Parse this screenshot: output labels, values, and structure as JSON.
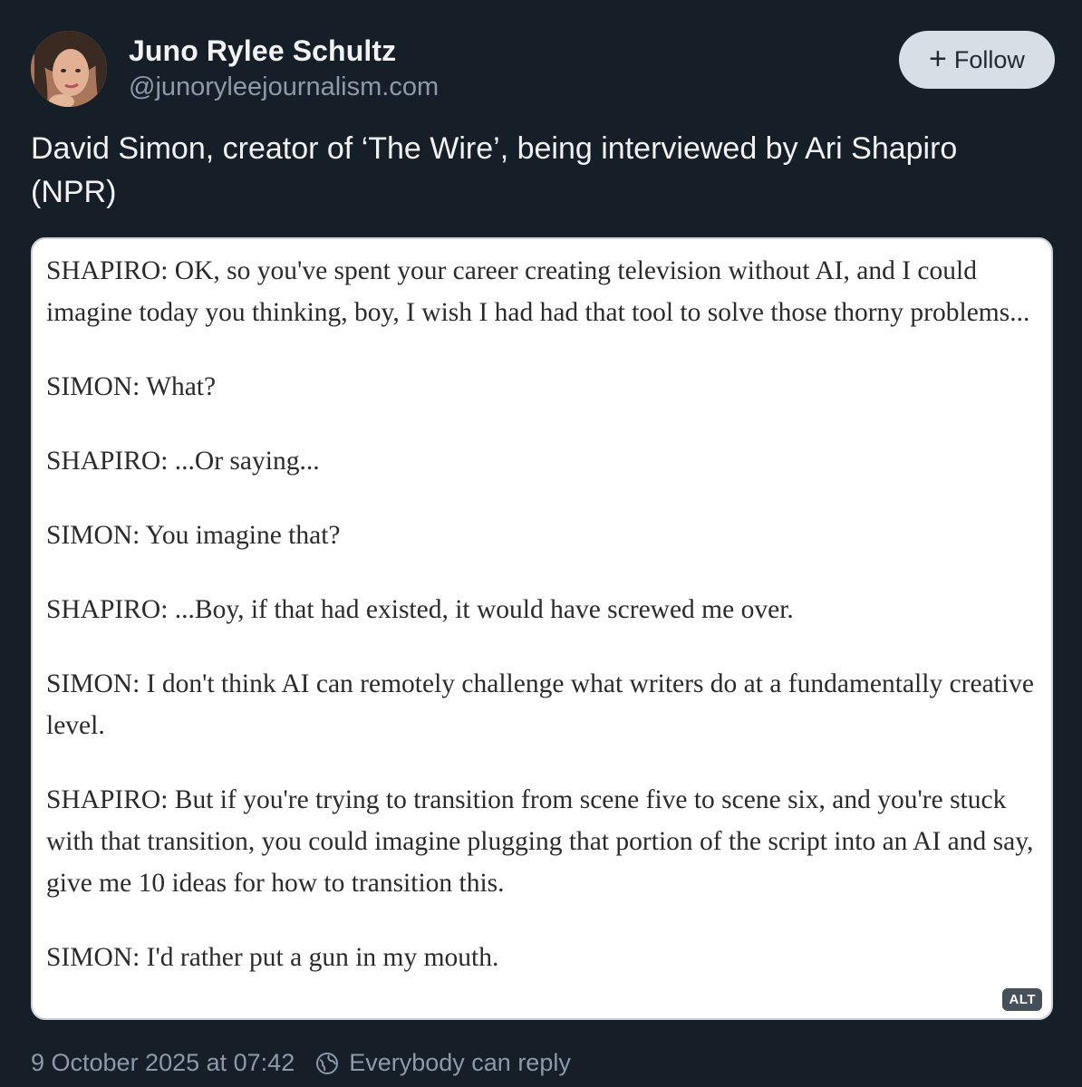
{
  "author": {
    "display_name": "Juno Rylee Schultz",
    "handle": "@junoryleejournalism.com"
  },
  "follow_button": {
    "icon": "plus-icon",
    "label": "Follow"
  },
  "post": {
    "text": "David Simon, creator of ‘The Wire’, being interviewed by Ari Shapiro (NPR)"
  },
  "image": {
    "alt_badge": "ALT",
    "transcript": [
      "SHAPIRO: OK, so you've spent your career creating television without AI, and I could imagine today you thinking, boy, I wish I had had that tool to solve those thorny problems...",
      "SIMON: What?",
      "SHAPIRO: ...Or saying...",
      "SIMON: You imagine that?",
      "SHAPIRO: ...Boy, if that had existed, it would have screwed me over.",
      "SIMON: I don't think AI can remotely challenge what writers do at a fundamentally creative level.",
      "SHAPIRO: But if you're trying to transition from scene five to scene six, and you're stuck with that transition, you could imagine plugging that portion of the script into an AI and say, give me 10 ideas for how to transition this.",
      "SIMON: I'd rather put a gun in my mouth."
    ]
  },
  "footer": {
    "timestamp": "9 October 2025 at 07:42",
    "reply_setting": "Everybody can reply",
    "reply_icon": "globe-icon"
  },
  "colors": {
    "background": "#161e27",
    "text_primary": "#f1f3f5",
    "text_secondary": "#8d9aa8",
    "follow_button_bg": "#d8dee5"
  }
}
